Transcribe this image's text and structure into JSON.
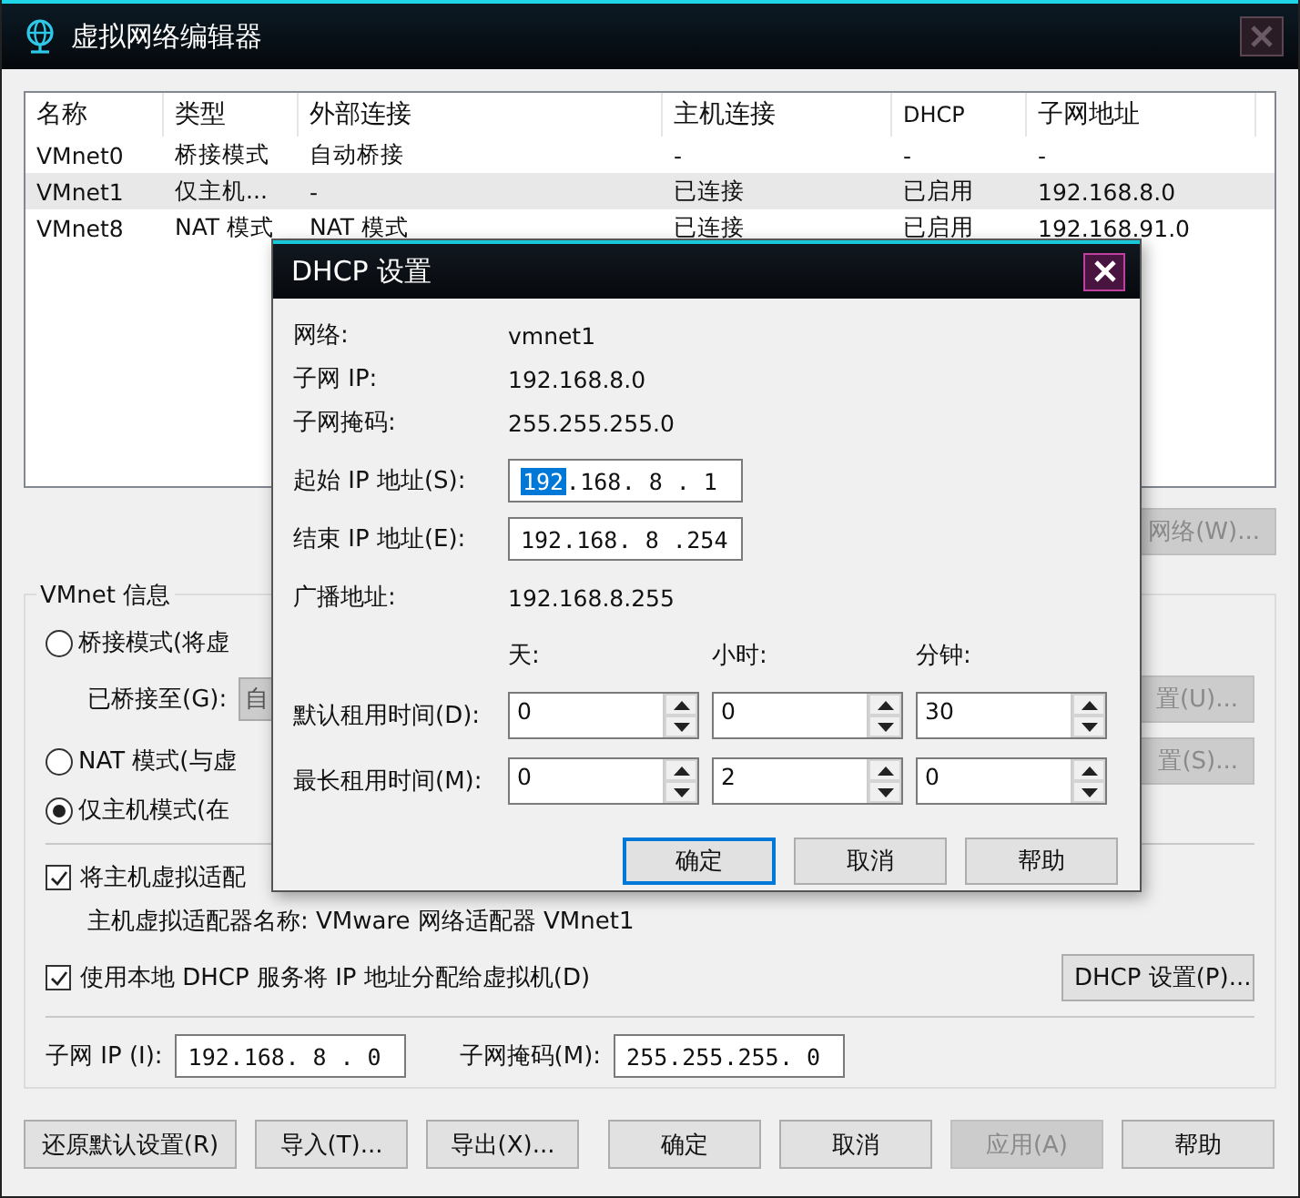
{
  "window": {
    "title": "虚拟网络编辑器"
  },
  "network_table": {
    "columns": [
      "名称",
      "类型",
      "外部连接",
      "主机连接",
      "DHCP",
      "子网地址"
    ],
    "rows": [
      {
        "cells": [
          "VMnet0",
          "桥接模式",
          "自动桥接",
          "-",
          "-",
          "-"
        ],
        "selected": false
      },
      {
        "cells": [
          "VMnet1",
          "仅主机...",
          "-",
          "已连接",
          "已启用",
          "192.168.8.0"
        ],
        "selected": true
      },
      {
        "cells": [
          "VMnet8",
          "NAT 模式",
          "NAT 模式",
          "已连接",
          "已启用",
          "192.168.91.0"
        ],
        "selected": false
      }
    ]
  },
  "rename_network_button": {
    "label": "网络(W)...",
    "disabled": true
  },
  "vmnet_info": {
    "title": "VMnet 信息",
    "modes": [
      {
        "label": "桥接模式(将虚",
        "selected": false
      },
      {
        "label": "NAT 模式(与虚",
        "selected": false
      },
      {
        "label": "仅主机模式(在",
        "selected": true
      }
    ],
    "bridged_to": {
      "label": "已桥接至(G):",
      "value": "自",
      "disabled": true
    },
    "bridge_settings_button": {
      "label": "置(U)...",
      "disabled": true
    },
    "nat_settings_button": {
      "label": "置(S)...",
      "disabled": true
    },
    "host_adapter_checkbox": {
      "label": "将主机虚拟适配",
      "checked": true
    },
    "adapter_name": "主机虚拟适配器名称: VMware 网络适配器 VMnet1",
    "dhcp_checkbox": {
      "label": "使用本地 DHCP 服务将 IP 地址分配给虚拟机(D)",
      "checked": true
    },
    "dhcp_settings_button": {
      "label": "DHCP 设置(P)...",
      "disabled": false
    },
    "subnet_ip": {
      "label": "子网 IP (I):",
      "separator": ".",
      "octets": [
        {
          "text": "192",
          "selected": false
        },
        {
          "text": "168",
          "selected": false
        },
        {
          "text": "8",
          "selected": false
        },
        {
          "text": "0",
          "selected": false
        }
      ]
    },
    "subnet_mask": {
      "label": "子网掩码(M):",
      "separator": ".",
      "octets": [
        {
          "text": "255",
          "selected": false
        },
        {
          "text": "255",
          "selected": false
        },
        {
          "text": "255",
          "selected": false
        },
        {
          "text": "0",
          "selected": false
        }
      ]
    }
  },
  "buttons": [
    {
      "label": "还原默认设置(R)",
      "disabled": false
    },
    {
      "label": "导入(T)...",
      "disabled": false
    },
    {
      "label": "导出(X)...",
      "disabled": false
    },
    {
      "label": "确定",
      "disabled": false
    },
    {
      "label": "取消",
      "disabled": false
    },
    {
      "label": "应用(A)",
      "disabled": true
    },
    {
      "label": "帮助",
      "disabled": false
    }
  ],
  "dhcp_dialog": {
    "title": "DHCP 设置",
    "info": [
      {
        "label": "网络:",
        "value": "vmnet1"
      },
      {
        "label": "子网 IP:",
        "value": "192.168.8.0"
      },
      {
        "label": "子网掩码:",
        "value": "255.255.255.0"
      }
    ],
    "ranges": [
      {
        "label": "起始 IP 地址(S):",
        "separator": ".",
        "octets": [
          {
            "text": "192",
            "selected": true
          },
          {
            "text": "168",
            "selected": false
          },
          {
            "text": "8",
            "selected": false
          },
          {
            "text": "1",
            "selected": false
          }
        ]
      },
      {
        "label": "结束 IP 地址(E):",
        "separator": ".",
        "octets": [
          {
            "text": "192",
            "selected": false
          },
          {
            "text": "168",
            "selected": false
          },
          {
            "text": "8",
            "selected": false
          },
          {
            "text": "254",
            "selected": false
          }
        ]
      }
    ],
    "broadcast": {
      "label": "广播地址:",
      "value": "192.168.8.255"
    },
    "lease_units": [
      "天:",
      "小时:",
      "分钟:"
    ],
    "leases": [
      {
        "label": "默认租用时间(D):",
        "values": [
          "0",
          "0",
          "30"
        ]
      },
      {
        "label": "最长租用时间(M):",
        "values": [
          "0",
          "2",
          "0"
        ]
      }
    ],
    "buttons": [
      {
        "label": "确定",
        "default": true
      },
      {
        "label": "取消",
        "default": false
      },
      {
        "label": "帮助",
        "default": false
      }
    ]
  }
}
